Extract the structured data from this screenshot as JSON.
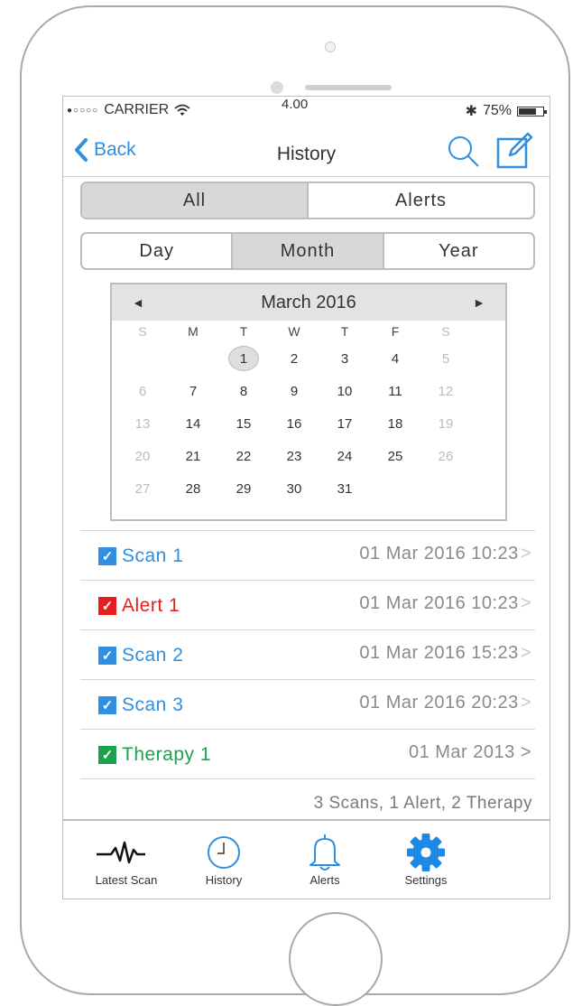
{
  "status_bar": {
    "carrier": "CARRIER",
    "time": "4.00",
    "battery_text": "75%",
    "battery_level": 0.75
  },
  "nav": {
    "back_label": "Back",
    "title": "History"
  },
  "filter_type": {
    "options": [
      "All",
      "Alerts"
    ],
    "selected": "All"
  },
  "range": {
    "options": [
      "Day",
      "Month",
      "Year"
    ],
    "selected": "Month"
  },
  "calendar": {
    "title": "March 2016",
    "prev_arrow": "◄",
    "next_arrow": "►",
    "weekdays": [
      "S",
      "M",
      "T",
      "W",
      "T",
      "F",
      "S"
    ],
    "first_weekday_index": 2,
    "days_in_month": 31,
    "selected_day": "1"
  },
  "records": [
    {
      "label": "Scan 1",
      "datetime": "01 Mar 2016 10:23",
      "kind": "scan",
      "color": "#2f8fe0"
    },
    {
      "label": "Alert 1",
      "datetime": "01 Mar 2016 10:23",
      "kind": "alert",
      "color": "#e81e1e"
    },
    {
      "label": "Scan 2",
      "datetime": "01 Mar 2016 15:23",
      "kind": "scan",
      "color": "#2f8fe0"
    },
    {
      "label": "Scan 3",
      "datetime": "01 Mar 2016 20:23",
      "kind": "scan",
      "color": "#2f8fe0"
    },
    {
      "label": "Therapy 1",
      "datetime": "01 Mar 2013 >",
      "kind": "therapy",
      "color": "#1aa34a"
    }
  ],
  "summary": "3 Scans, 1 Alert, 2 Therapy",
  "tabs": [
    {
      "label": "Latest Scan",
      "icon": "heartbeat-icon"
    },
    {
      "label": "History",
      "icon": "clock-icon"
    },
    {
      "label": "Alerts",
      "icon": "bell-icon"
    },
    {
      "label": "Settings",
      "icon": "gear-icon"
    }
  ],
  "colors": {
    "accent": "#2f8fe0",
    "alert": "#e81e1e",
    "therapy": "#1aa34a",
    "settings_icon": "#1e88e5"
  }
}
